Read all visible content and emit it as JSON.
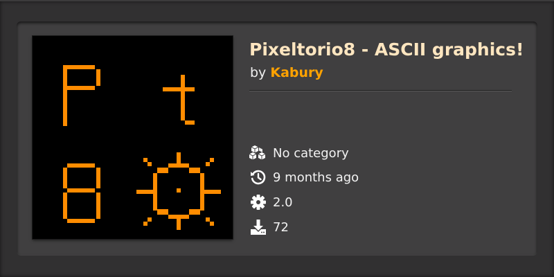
{
  "mod": {
    "title": "Pixeltorio8 - ASCII graphics!",
    "by_label": "by",
    "author": "Kabury",
    "meta": {
      "category": {
        "icon": "category-cubes-icon",
        "text": "No category"
      },
      "updated": {
        "icon": "history-icon",
        "text": "9 months ago"
      },
      "version": {
        "icon": "gear-icon",
        "text": "2.0"
      },
      "downloads": {
        "icon": "download-icon",
        "text": "72"
      }
    },
    "thumbnail": {
      "glyphs": [
        "P",
        "t",
        "8",
        "gear"
      ],
      "glyph_color": "#ff8c00",
      "background": "#000000"
    }
  },
  "colors": {
    "title": "#ffe6c0",
    "author": "#ffa200",
    "panel": "#403f40"
  }
}
